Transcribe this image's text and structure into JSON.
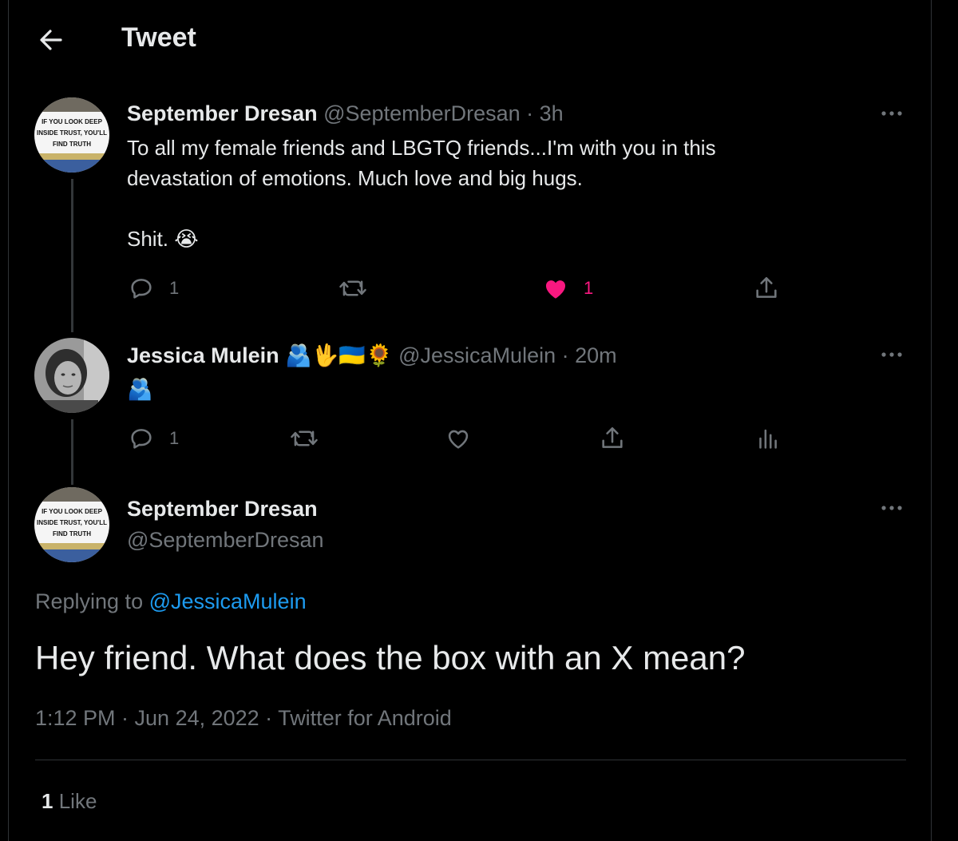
{
  "header": {
    "title": "Tweet",
    "back_icon": "arrow-left-icon"
  },
  "tweets": [
    {
      "name": "September Dresan",
      "handle": "@SeptemberDresan",
      "time": "· 3h",
      "text_lines": [
        "To all my female friends and LBGTQ friends...I'm with you in this",
        "devastation of emotions. Much love and big hugs."
      ],
      "text_last": "Shit. 😭",
      "avatar_text": [
        "IF YOU LOOK DEEP",
        "INSIDE TRUST, YOU'LL",
        "FIND TRUTH"
      ],
      "reply_count": "1",
      "like_count": "1",
      "liked": true
    },
    {
      "name": "Jessica Mulein",
      "name_emoji": "🫂🖖🇺🇦🌻",
      "handle": "@JessicaMulein",
      "time": "· 20m",
      "text": "🫂",
      "reply_count": "1"
    }
  ],
  "main_tweet": {
    "name": "September Dresan",
    "handle": "@SeptemberDresan",
    "avatar_text": [
      "IF YOU LOOK DEEP",
      "INSIDE TRUST, YOU'LL",
      "FIND TRUTH"
    ],
    "replying_prefix": "Replying to",
    "replying_to": "@JessicaMulein",
    "text": "Hey friend. What does the box with an X mean?",
    "timestamp": "1:12 PM · Jun 24, 2022 · Twitter for Android",
    "like_count": "1",
    "like_label": "Like"
  },
  "colors": {
    "background": "#000000",
    "text": "#e7e9ea",
    "muted": "#71767b",
    "link": "#1d9bf0",
    "like_pink": "#f91880"
  }
}
